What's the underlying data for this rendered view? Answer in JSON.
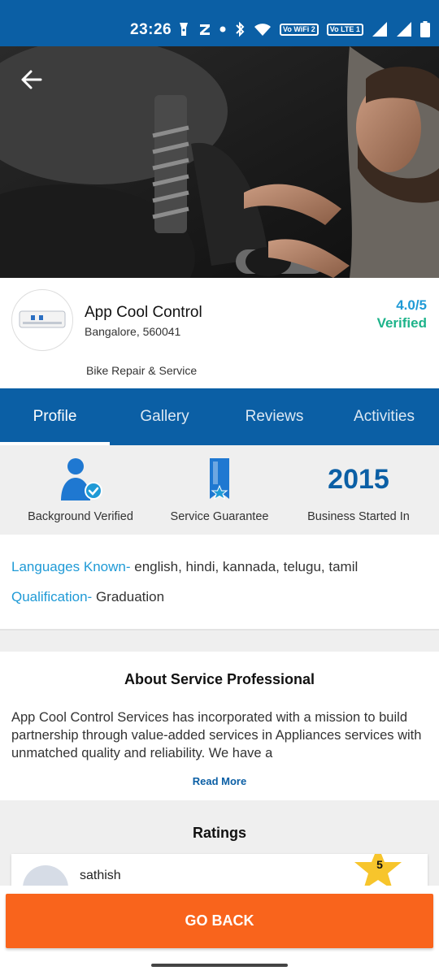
{
  "status_bar": {
    "time": "23:26",
    "icons": [
      "torch-icon",
      "z-icon",
      "dot-icon",
      "bluetooth-icon",
      "wifi-icon",
      "volte-wifi-icon",
      "volte-lte-icon",
      "signal-icon",
      "signal-icon",
      "battery-icon"
    ],
    "tag_wifi": "Vo WiFi 2",
    "tag_lte": "Vo LTE 1"
  },
  "header": {
    "back_icon": "arrow-left-icon"
  },
  "profile": {
    "name": "App Cool Control",
    "location": "Bangalore, 560041",
    "rating": "4.0/5",
    "verified": "Verified",
    "category": "Bike Repair & Service"
  },
  "tabs": [
    {
      "label": "Profile",
      "active": true
    },
    {
      "label": "Gallery",
      "active": false
    },
    {
      "label": "Reviews",
      "active": false
    },
    {
      "label": "Activities",
      "active": false
    }
  ],
  "highlights": {
    "background": {
      "label": "Background Verified",
      "icon": "verified-user-icon"
    },
    "guarantee": {
      "label": "Service Guarantee",
      "icon": "badge-star-icon"
    },
    "year": {
      "value": "2015",
      "label": "Business Started In"
    }
  },
  "details": {
    "languages_key": "Languages Known-",
    "languages_value": " english, hindi, kannada, telugu, tamil",
    "qualification_key": "Qualification-",
    "qualification_value": " Graduation"
  },
  "about": {
    "title": "About Service Professional",
    "text": "App Cool Control Services has incorporated with a mission to build partnership through value-added services in Appliances services with unmatched quality and reliability. We have a",
    "read_more": "Read More"
  },
  "ratings": {
    "title": "Ratings",
    "reviews": [
      {
        "name": "sathish",
        "stars": "5"
      }
    ]
  },
  "footer": {
    "go_back": "GO BACK"
  },
  "colors": {
    "primary": "#0b5fa5",
    "accent_blue": "#1f9ad6",
    "verified_green": "#1db38a",
    "cta_orange": "#f9641c",
    "star_yellow": "#f7c52c"
  }
}
